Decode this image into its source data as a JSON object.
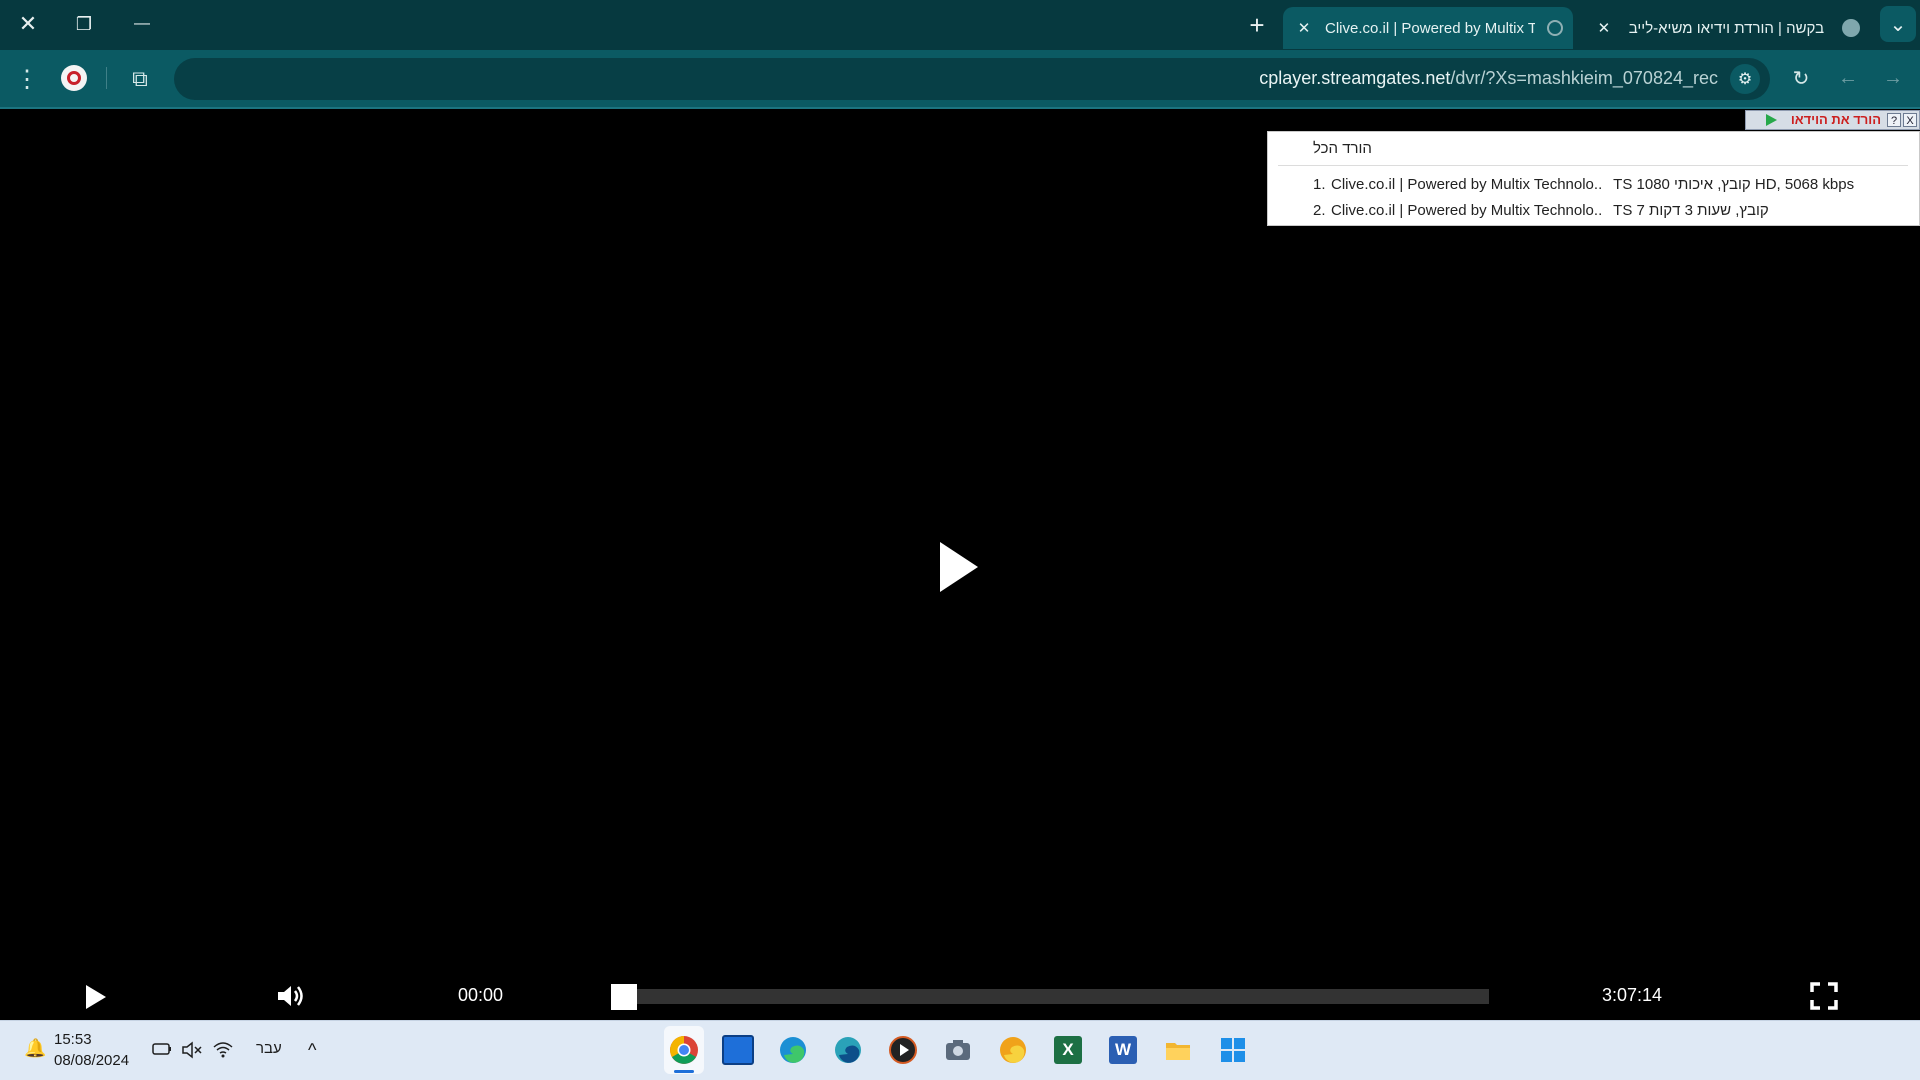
{
  "window": {
    "close_glyph": "✕",
    "restore_glyph": "❐",
    "minimize_glyph": "—"
  },
  "tabs": {
    "new_tab_glyph": "+",
    "active": {
      "title": "Clive.co.il | Powered by Multix T",
      "close_glyph": "✕"
    },
    "other": {
      "title": "בקשה | הורדת וידיאו משיא-לייב",
      "close_glyph": "✕"
    },
    "menu_glyph": "⌄"
  },
  "toolbar": {
    "menu_glyph": "⋮",
    "extensions_glyph": "⧉",
    "bookmark_glyph": "☆",
    "reload_glyph": "↻",
    "back_glyph": "←",
    "forward_glyph": "→",
    "site_settings_glyph": "⚙"
  },
  "omnibox": {
    "host": "cplayer.streamgates.net",
    "path": "/dvr/?Xs=mashkieim_070824_rec"
  },
  "download_bar": {
    "label": "הורד את הוידאו",
    "help_glyph": "?",
    "close_glyph": "X"
  },
  "download_menu": {
    "all_label": "הורד הכל",
    "items": [
      {
        "num": "1.",
        "source": "Clive.co.il | Powered by Multix Technolo...",
        "details": "TS 1080 קובץ, איכותי HD, 5068 kbps"
      },
      {
        "num": "2.",
        "source": "Clive.co.il | Powered by Multix Technolo...",
        "details": "TS 7 קובץ, שעות 3 דקות"
      }
    ]
  },
  "player": {
    "current_time": "00:00",
    "duration": "3:07:14",
    "progress_fraction": 0
  },
  "taskbar": {
    "time": "15:53",
    "date": "08/08/2024",
    "language": "עבר",
    "chevron_glyph": "^",
    "bell_glyph": "🔔",
    "apps": [
      "chrome-icon",
      "store-icon",
      "edge-icon",
      "edge-dev-icon",
      "media-player-icon",
      "camera-icon",
      "edge-canary-icon",
      "excel-icon",
      "word-icon",
      "file-explorer-icon",
      "windows-start-icon"
    ]
  },
  "colors": {
    "tabstrip": "#06393f",
    "toolbar": "#0b5a63",
    "taskbar": "#dfe9f5",
    "accent": "#1e6fd9"
  }
}
